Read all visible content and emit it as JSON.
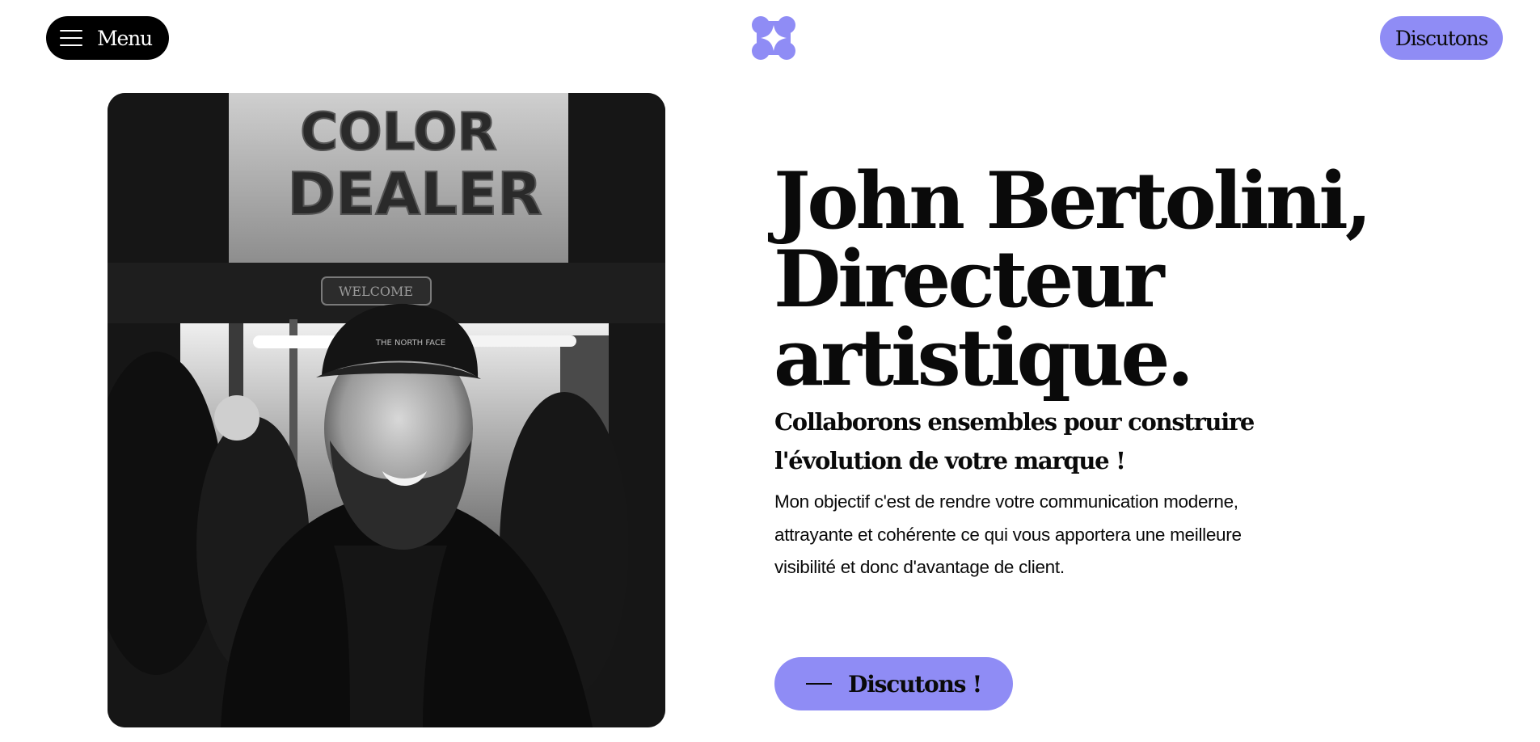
{
  "header": {
    "menu_label": "Menu",
    "cta_label": "Discutons",
    "logo_icon": "star-flower-logo-icon",
    "accent_color": "#8f8cf5"
  },
  "photo": {
    "alt": "Portrait noir et blanc d'un homme souriant portant une casquette devant une vitrine",
    "storefront_sign": "COLOR DEALER",
    "door_sign": "WELCOME"
  },
  "hero": {
    "title_line1": "John Bertolini,",
    "title_line2": "Directeur",
    "title_line3": "artistique.",
    "subtitle": "Collaborons ensembles pour construire l'évolution de votre marque !",
    "description": "Mon objectif c'est de rendre votre communication moderne, attrayante et cohérente ce qui vous apportera une meilleure visibilité et donc d'avantage de client.",
    "cta_label": "Discutons !"
  }
}
